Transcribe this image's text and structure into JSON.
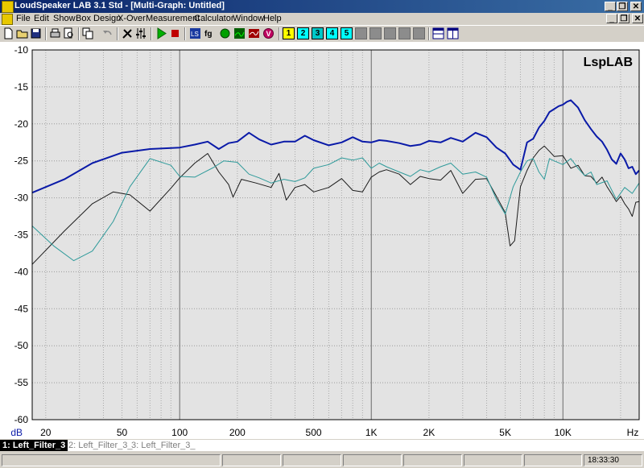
{
  "window": {
    "title": "LoudSpeaker LAB 3.1 Std - [Multi-Graph: Untitled]",
    "buttons": [
      "_",
      "❐",
      "✕"
    ]
  },
  "menu": {
    "items": [
      "File",
      "Edit",
      "Show",
      "Box Design",
      "X-Over",
      "Measurement",
      "Calculator",
      "Window",
      "Help"
    ],
    "mdi_buttons": [
      "_",
      "❐",
      "✕"
    ]
  },
  "toolbar": {
    "icons": [
      "new-icon",
      "open-icon",
      "save-icon",
      "print-icon",
      "print-preview-icon",
      "copy-icon",
      "undo-icon",
      "tools-icon",
      "sliders-icon",
      "play-icon",
      "lsp-icon",
      "fg-icon",
      "green-circle-icon",
      "red-response-icon",
      "v-icon"
    ],
    "numbered": [
      "1",
      "2",
      "3",
      "4",
      "5"
    ],
    "numbered_colors": [
      "#ffff00",
      "#00ffff",
      "#00c8c8",
      "#00ffff",
      "#00ffff"
    ]
  },
  "chart_data": {
    "type": "line",
    "brand_label": "LspLAB",
    "ylabel": "dB",
    "xlabel_unit": "Hz",
    "x_scale": "log",
    "xlim": [
      17,
      1000000
    ],
    "xlim_note": "x axis runs 17 Hz to about 25 kHz",
    "ylim": [
      -60,
      -10
    ],
    "y_ticks": [
      -10,
      -15,
      -20,
      -25,
      -30,
      -35,
      -40,
      -45,
      -50,
      -55,
      -60
    ],
    "y_tick_labels": [
      "-10",
      "-15",
      "-20",
      "-25",
      "-30",
      "-35",
      "-40",
      "-45",
      "-50",
      "-55",
      "-60"
    ],
    "x_tick_values": [
      20,
      50,
      100,
      200,
      500,
      1000,
      2000,
      5000,
      10000
    ],
    "x_tick_labels": [
      "20",
      "50",
      "100",
      "200",
      "500",
      "1K",
      "2K",
      "5K",
      "10K"
    ],
    "grid": true,
    "series": [
      {
        "name": "1: Left_Filter_3",
        "color": "#0a1aa8",
        "x": [
          17,
          25,
          35,
          50,
          70,
          100,
          120,
          140,
          160,
          180,
          200,
          230,
          260,
          300,
          350,
          400,
          450,
          500,
          600,
          700,
          800,
          900,
          1000,
          1100,
          1200,
          1400,
          1600,
          1800,
          2000,
          2300,
          2600,
          3000,
          3500,
          4000,
          4500,
          5000,
          5500,
          6000,
          6500,
          7000,
          7500,
          8000,
          8500,
          9000,
          9500,
          10000,
          10500,
          11000,
          12000,
          13000,
          14000,
          15000,
          16000,
          17000,
          18000,
          19000,
          20000,
          21000,
          22000,
          23000,
          24000,
          25000
        ],
        "y": [
          -29.3,
          -27.5,
          -25.3,
          -23.9,
          -23.4,
          -23.2,
          -22.8,
          -22.4,
          -23.4,
          -22.6,
          -22.4,
          -21.2,
          -22.1,
          -22.8,
          -22.4,
          -22.4,
          -21.6,
          -22.2,
          -22.9,
          -22.5,
          -21.8,
          -22.4,
          -22.5,
          -22.2,
          -22.3,
          -22.6,
          -23.0,
          -22.8,
          -22.3,
          -22.5,
          -21.9,
          -22.4,
          -21.2,
          -21.8,
          -23.2,
          -24.0,
          -25.5,
          -26.2,
          -22.5,
          -22.0,
          -20.5,
          -19.6,
          -18.4,
          -18.0,
          -17.6,
          -17.4,
          -17.0,
          -16.8,
          -17.8,
          -19.5,
          -20.7,
          -21.7,
          -22.4,
          -23.5,
          -24.8,
          -25.4,
          -24.0,
          -24.8,
          -26.0,
          -25.8,
          -26.8,
          -26.3
        ]
      },
      {
        "name": "2: Left_Filter_3_",
        "color": "#2e9a9a",
        "x": [
          17,
          22,
          28,
          35,
          45,
          55,
          70,
          90,
          100,
          120,
          150,
          170,
          200,
          230,
          260,
          300,
          350,
          400,
          450,
          500,
          600,
          700,
          800,
          900,
          1000,
          1100,
          1200,
          1400,
          1600,
          1800,
          2000,
          2300,
          2600,
          3000,
          3500,
          4000,
          4500,
          5000,
          5500,
          6000,
          6500,
          7000,
          7500,
          8000,
          8500,
          9000,
          10000,
          11000,
          12000,
          13000,
          14000,
          15000,
          17000,
          19000,
          21000,
          23000,
          25000
        ],
        "y": [
          -33.8,
          -36.5,
          -38.5,
          -37.2,
          -33.2,
          -28.5,
          -24.7,
          -25.6,
          -27.1,
          -27.2,
          -25.9,
          -25.0,
          -25.2,
          -26.8,
          -27.3,
          -28.0,
          -27.5,
          -27.8,
          -27.3,
          -26.0,
          -25.5,
          -24.6,
          -24.9,
          -24.6,
          -26.0,
          -25.3,
          -25.8,
          -26.5,
          -27.1,
          -26.2,
          -26.5,
          -25.8,
          -25.3,
          -26.8,
          -26.5,
          -27.2,
          -30.2,
          -32.2,
          -28.5,
          -26.5,
          -25.0,
          -24.7,
          -26.5,
          -27.5,
          -24.7,
          -25.0,
          -25.5,
          -24.7,
          -26.0,
          -27.0,
          -26.5,
          -28.2,
          -27.7,
          -30.2,
          -28.6,
          -29.4,
          -28.0
        ]
      },
      {
        "name": "3: Left_Filter_3_",
        "color": "#1a1a1a",
        "x": [
          17,
          25,
          35,
          45,
          55,
          70,
          90,
          100,
          120,
          140,
          160,
          180,
          190,
          210,
          250,
          300,
          330,
          360,
          400,
          450,
          500,
          600,
          700,
          800,
          900,
          1000,
          1100,
          1200,
          1400,
          1600,
          1800,
          2000,
          2300,
          2600,
          3000,
          3500,
          4000,
          4500,
          5000,
          5300,
          5600,
          5800,
          6000,
          6500,
          7000,
          7500,
          8000,
          8500,
          9000,
          10000,
          11000,
          12000,
          13000,
          14000,
          15000,
          16000,
          17000,
          18000,
          19000,
          20000,
          21000,
          22000,
          23000,
          24000,
          25000
        ],
        "y": [
          -39.0,
          -34.5,
          -30.8,
          -29.2,
          -29.6,
          -31.8,
          -28.7,
          -27.3,
          -25.3,
          -24.0,
          -26.5,
          -28.2,
          -29.9,
          -27.5,
          -28.0,
          -28.6,
          -26.7,
          -30.3,
          -28.6,
          -28.2,
          -29.2,
          -28.6,
          -27.4,
          -29.0,
          -29.2,
          -27.2,
          -26.5,
          -26.2,
          -26.8,
          -28.2,
          -27.1,
          -27.4,
          -27.6,
          -26.3,
          -29.4,
          -27.5,
          -27.4,
          -29.8,
          -32.0,
          -36.5,
          -35.8,
          -32.0,
          -28.5,
          -26.3,
          -24.6,
          -23.6,
          -23.0,
          -23.7,
          -24.4,
          -24.3,
          -26.0,
          -25.6,
          -27.0,
          -27.1,
          -28.0,
          -27.2,
          -28.5,
          -29.5,
          -30.5,
          -29.8,
          -30.8,
          -31.5,
          -32.5,
          -30.6,
          -30.5
        ]
      }
    ]
  },
  "tabs": [
    {
      "label": "1: Left_Filter_3",
      "active": true
    },
    {
      "label": "2: Left_Filter_3_",
      "active": false
    },
    {
      "label": "3: Left_Filter_3_",
      "active": false
    }
  ],
  "status": {
    "time": "18:33:30"
  }
}
